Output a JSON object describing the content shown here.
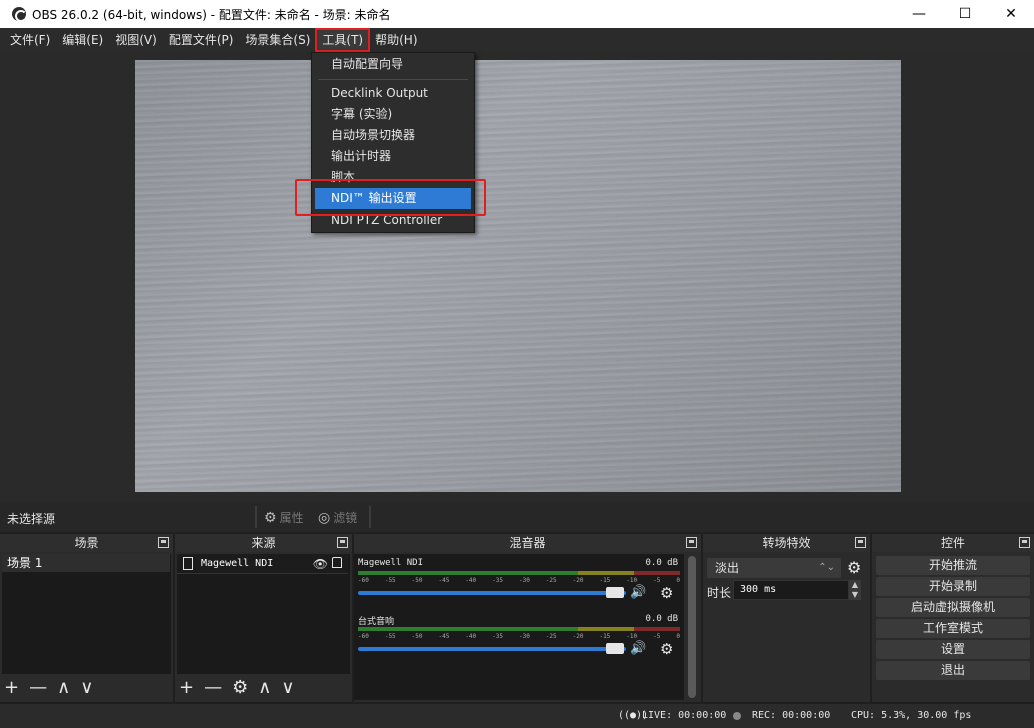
{
  "window": {
    "title": "OBS 26.0.2 (64-bit, windows) - 配置文件: 未命名 - 场景: 未命名",
    "minimize": "—",
    "maximize": "☐",
    "close": "✕"
  },
  "menubar": {
    "items": [
      {
        "label": "文件(F)"
      },
      {
        "label": "编辑(E)"
      },
      {
        "label": "视图(V)"
      },
      {
        "label": "配置文件(P)"
      },
      {
        "label": "场景集合(S)"
      },
      {
        "label": "工具(T)"
      },
      {
        "label": "帮助(H)"
      }
    ],
    "active_index": 5
  },
  "tools_menu": {
    "items": [
      {
        "label": "自动配置向导"
      },
      {
        "label": "Decklink Output"
      },
      {
        "label": "字幕 (实验)"
      },
      {
        "label": "自动场景切换器"
      },
      {
        "label": "输出计时器"
      },
      {
        "label": "脚本"
      },
      {
        "label": "NDI™ 输出设置",
        "selected": true
      },
      {
        "label": "NDI PTZ Controller"
      }
    ]
  },
  "source_toolbar": {
    "no_source": "未选择源",
    "properties": "属性",
    "filters": "滤镜",
    "properties_icon": "gear-icon",
    "filters_icon": "filter-icon"
  },
  "scenes": {
    "title": "场景",
    "items": [
      "场景 1"
    ]
  },
  "sources": {
    "title": "来源",
    "items": [
      {
        "name": "Magewell NDI"
      }
    ]
  },
  "mixer": {
    "title": "混音器",
    "channels": [
      {
        "name": "Magewell NDI",
        "db": "0.0 dB"
      },
      {
        "name": "台式音响",
        "db": "0.0 dB"
      }
    ],
    "scale": [
      "-60",
      "-55",
      "-50",
      "-45",
      "-40",
      "-35",
      "-30",
      "-25",
      "-20",
      "-15",
      "-10",
      "-5",
      "0"
    ]
  },
  "transitions": {
    "title": "转场特效",
    "selected": "淡出",
    "duration_label": "时长",
    "duration_value": "300 ms"
  },
  "controls": {
    "title": "控件",
    "buttons": [
      "开始推流",
      "开始录制",
      "启动虚拟摄像机",
      "工作室模式",
      "设置",
      "退出"
    ]
  },
  "status": {
    "live": "LIVE: 00:00:00",
    "rec": "REC: 00:00:00",
    "cpu": "CPU: 5.3%, 30.00 fps"
  },
  "colors": {
    "accent": "#2e7bd6",
    "highlight_red": "#e02020",
    "panel_bg": "#2b2b2b"
  }
}
